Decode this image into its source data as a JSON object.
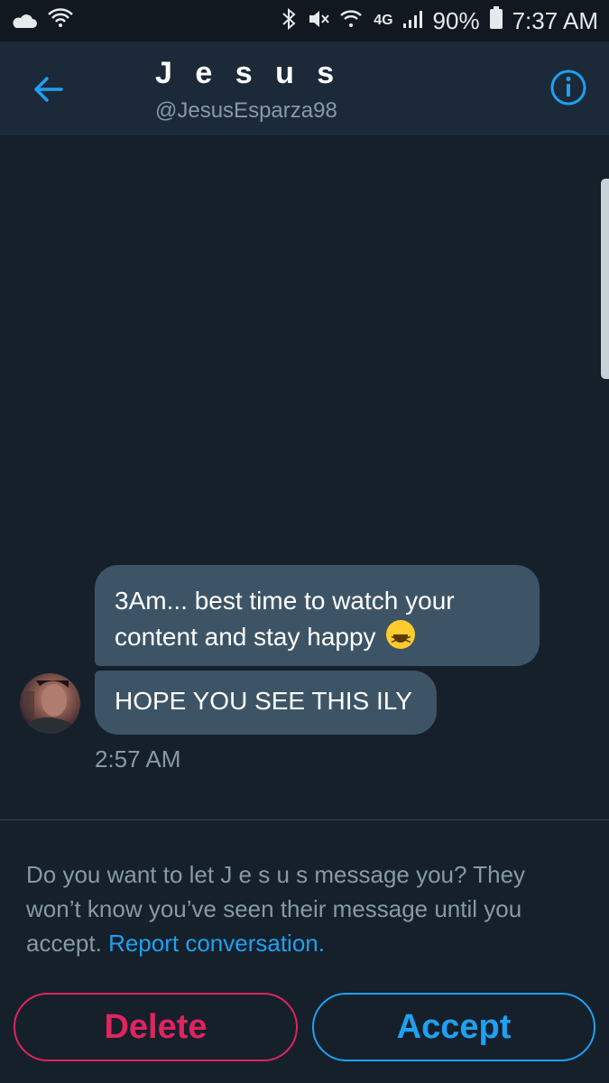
{
  "status_bar": {
    "battery": "90%",
    "time": "7:37 AM",
    "network": "4G",
    "icons": [
      "cloud-icon",
      "wifi-icon",
      "bluetooth-icon",
      "mute-icon",
      "wifi-icon",
      "signal-icon",
      "battery-icon"
    ]
  },
  "header": {
    "title": "J e s u s",
    "handle": "@JesusEsparza98",
    "back_icon": "arrow-left-icon",
    "info_icon": "info-icon"
  },
  "messages": [
    {
      "text": "3Am... best time to watch your content and stay happy",
      "emoji": "laughing-emoji-icon"
    },
    {
      "text": "HOPE YOU SEE THIS ILY"
    }
  ],
  "timestamp": "2:57 AM",
  "request": {
    "prompt": "Do you want to let J e s u s message you? They won’t know you’ve seen their message until you accept.",
    "report_link": "Report conversation.",
    "delete_label": "Delete",
    "accept_label": "Accept"
  },
  "colors": {
    "background": "#15202b",
    "header": "#1c2938",
    "bubble": "#3d5466",
    "accent": "#1da1f2",
    "danger": "#e0245e",
    "muted": "#8899a6"
  }
}
